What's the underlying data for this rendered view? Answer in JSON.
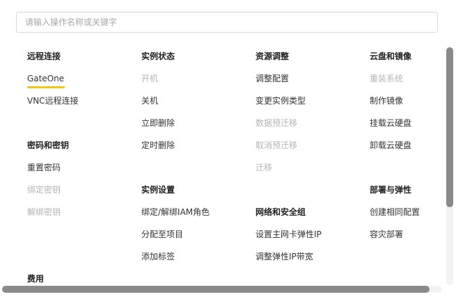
{
  "search": {
    "placeholder": "请输入操作名称或关键字",
    "value": ""
  },
  "colors": {
    "accent": "#f5c518",
    "disabled": "#b4b4b4"
  },
  "columns": [
    {
      "groups": [
        {
          "title": "远程连接",
          "items": [
            {
              "label": "GateOne",
              "state": "active"
            },
            {
              "label": "VNC远程连接",
              "state": "enabled"
            }
          ]
        },
        {
          "title": "密码和密钥",
          "items": [
            {
              "label": "重置密码",
              "state": "enabled"
            },
            {
              "label": "绑定密钥",
              "state": "disabled"
            },
            {
              "label": "解绑密钥",
              "state": "disabled"
            }
          ]
        },
        {
          "title": "费用",
          "items": []
        }
      ]
    },
    {
      "groups": [
        {
          "title": "实例状态",
          "items": [
            {
              "label": "开机",
              "state": "disabled"
            },
            {
              "label": "关机",
              "state": "enabled"
            },
            {
              "label": "立即删除",
              "state": "enabled"
            },
            {
              "label": "定时删除",
              "state": "enabled"
            }
          ]
        },
        {
          "title": "实例设置",
          "items": [
            {
              "label": "绑定/解绑IAM角色",
              "state": "enabled"
            },
            {
              "label": "分配至项目",
              "state": "enabled"
            },
            {
              "label": "添加标签",
              "state": "enabled"
            }
          ]
        }
      ]
    },
    {
      "groups": [
        {
          "title": "资源调整",
          "items": [
            {
              "label": "调整配置",
              "state": "enabled"
            },
            {
              "label": "变更实例类型",
              "state": "enabled"
            },
            {
              "label": "数据预迁移",
              "state": "disabled"
            },
            {
              "label": "取消预迁移",
              "state": "disabled"
            },
            {
              "label": "迁移",
              "state": "disabled"
            }
          ]
        },
        {
          "title": "网络和安全组",
          "items": [
            {
              "label": "设置主网卡弹性IP",
              "state": "enabled"
            },
            {
              "label": "调整弹性IP带宽",
              "state": "enabled"
            }
          ]
        }
      ]
    },
    {
      "groups": [
        {
          "title": "云盘和镜像",
          "items": [
            {
              "label": "重装系统",
              "state": "disabled"
            },
            {
              "label": "制作镜像",
              "state": "enabled"
            },
            {
              "label": "挂载云硬盘",
              "state": "enabled"
            },
            {
              "label": "卸载云硬盘",
              "state": "enabled"
            }
          ]
        },
        {
          "title": "部署与弹性",
          "items": [
            {
              "label": "创建相同配置",
              "state": "enabled"
            },
            {
              "label": "容灾部署",
              "state": "enabled"
            }
          ]
        }
      ]
    }
  ]
}
